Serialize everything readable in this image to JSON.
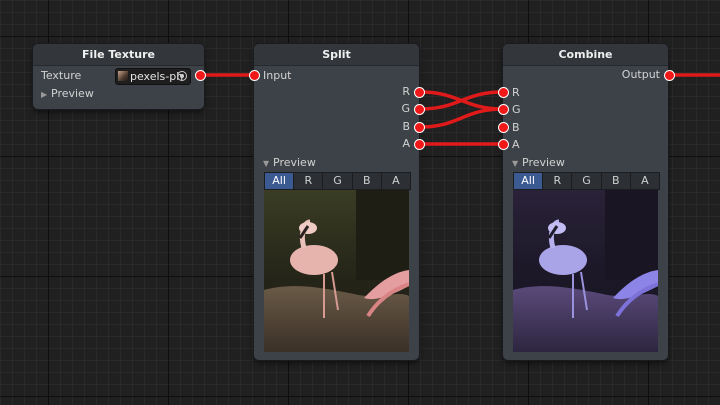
{
  "colors": {
    "wire": "#e01a1a",
    "port": "#f01818",
    "accent_tab": "#3c5a92",
    "node_bg": "#3d4248",
    "header_bg": "#33373c"
  },
  "nodes": {
    "file_texture": {
      "title": "File Texture",
      "texture_label": "Texture",
      "texture_value": "pexels-ph",
      "texture_icon": "image-thumbnail-icon",
      "picker_icon": "object-picker-icon",
      "preview_label": "Preview",
      "preview_expanded": false
    },
    "split": {
      "title": "Split",
      "input_label": "Input",
      "outputs": [
        "R",
        "G",
        "B",
        "A"
      ],
      "preview_label": "Preview",
      "preview_expanded": true,
      "tabs": [
        "All",
        "R",
        "G",
        "B",
        "A"
      ],
      "active_tab": "All"
    },
    "combine": {
      "title": "Combine",
      "inputs": [
        "R",
        "G",
        "B",
        "A"
      ],
      "output_label": "Output",
      "preview_label": "Preview",
      "preview_expanded": true,
      "tabs": [
        "All",
        "R",
        "G",
        "B",
        "A"
      ],
      "active_tab": "All"
    }
  },
  "connections": [
    {
      "from": "File Texture.Texture",
      "to": "Split.Input"
    },
    {
      "from": "Split.R",
      "to": "Combine.G"
    },
    {
      "from": "Split.G",
      "to": "Combine.R"
    },
    {
      "from": "Split.B",
      "to": "Combine.G"
    },
    {
      "from": "Split.A",
      "to": "Combine.A"
    },
    {
      "from": "Combine.Output",
      "to": "offscreen"
    }
  ]
}
